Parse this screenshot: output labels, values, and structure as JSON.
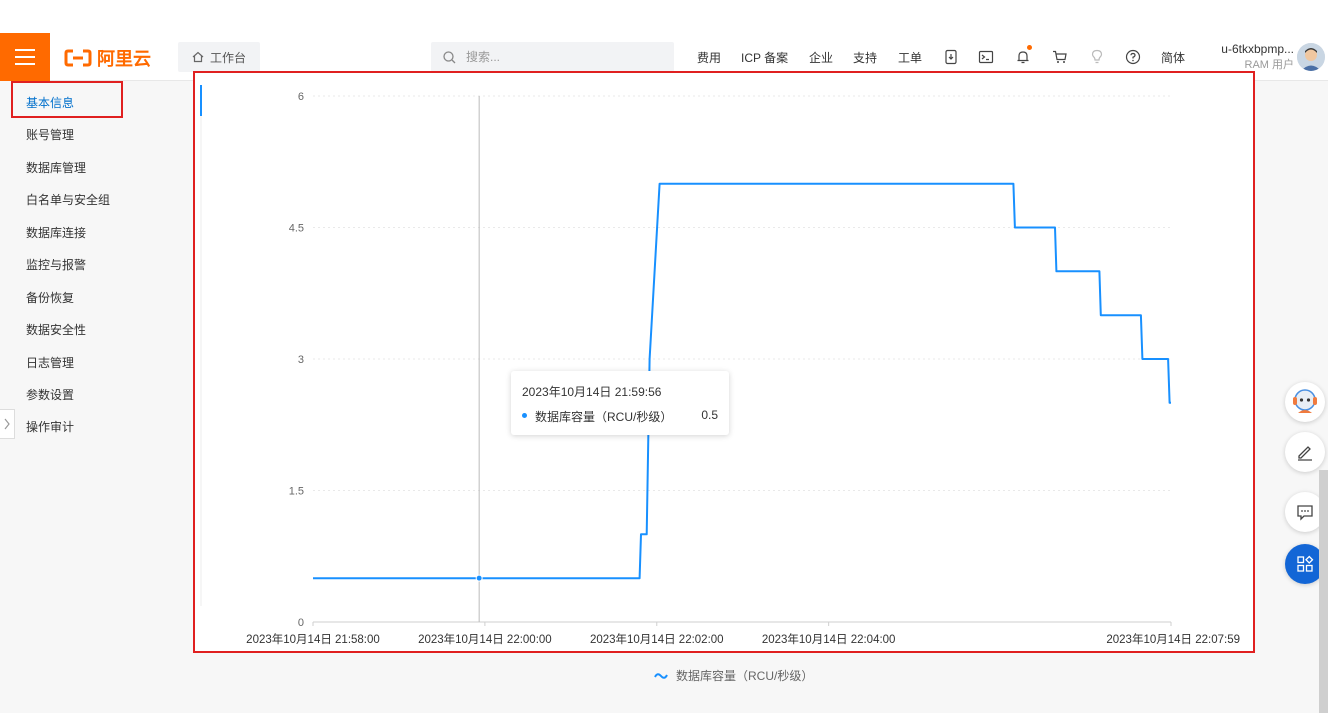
{
  "header": {
    "logo_text": "阿里云",
    "workbench_label": "工作台",
    "search_placeholder": "搜索...",
    "nav": [
      "费用",
      "ICP 备案",
      "企业",
      "支持",
      "工单"
    ],
    "language": "简体",
    "user": {
      "name": "u-6tkxbpmp...",
      "role": "RAM 用户"
    }
  },
  "sidebar": {
    "items": [
      "基本信息",
      "账号管理",
      "数据库管理",
      "白名单与安全组",
      "数据库连接",
      "监控与报警",
      "备份恢复",
      "数据安全性",
      "日志管理",
      "参数设置",
      "操作审计"
    ],
    "active_index": 0
  },
  "colors": {
    "brand": "#ff6a00",
    "accent": "#0070cc",
    "series": "#1890ff",
    "highlight": "#e02020"
  },
  "tooltip": {
    "time": "2023年10月14日 21:59:56",
    "series": "数据库容量（RCU/秒级）",
    "value": "0.5"
  },
  "chart_data": {
    "type": "line",
    "x_ticks": [
      "2023年10月14日 21:58:00",
      "2023年10月14日 22:00:00",
      "2023年10月14日 22:02:00",
      "2023年10月14日 22:04:00",
      "2023年10月14日 22:07:59"
    ],
    "y_ticks": [
      "0",
      "1.5",
      "3",
      "4.5",
      "6"
    ],
    "ylim": [
      0,
      6
    ],
    "xlim": [
      "2023-10-14 21:58:00",
      "2023-10-14 22:07:59"
    ],
    "grid": true,
    "legend_position": "bottom-center",
    "series": [
      {
        "name": "数据库容量（RCU/秒级）",
        "x": [
          "2023-10-14 21:58:00",
          "2023-10-14 22:01:48",
          "2023-10-14 22:01:49",
          "2023-10-14 22:01:53",
          "2023-10-14 22:01:55",
          "2023-10-14 22:02:02",
          "2023-10-14 22:06:09",
          "2023-10-14 22:06:10",
          "2023-10-14 22:06:38",
          "2023-10-14 22:06:39",
          "2023-10-14 22:07:09",
          "2023-10-14 22:07:10",
          "2023-10-14 22:07:38",
          "2023-10-14 22:07:39",
          "2023-10-14 22:07:57",
          "2023-10-14 22:07:58",
          "2023-10-14 22:07:59"
        ],
        "y": [
          0.5,
          0.5,
          1.0,
          1.0,
          3.0,
          5.0,
          5.0,
          4.5,
          4.5,
          4.0,
          4.0,
          3.5,
          3.5,
          3.0,
          3.0,
          2.5,
          2.5
        ]
      }
    ],
    "hover": {
      "x": "2023-10-14 21:59:56",
      "y": 0.5
    }
  }
}
